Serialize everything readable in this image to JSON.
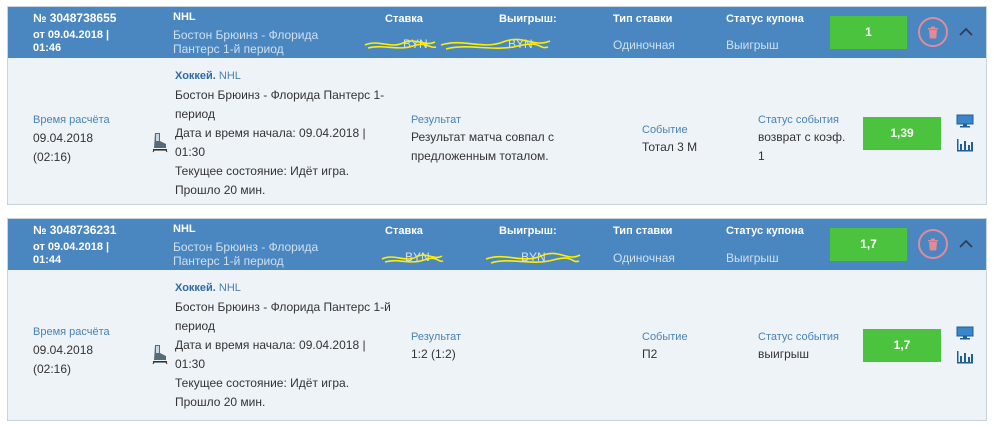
{
  "coupons": [
    {
      "number": "№ 3048738655",
      "date_line1": "от 09.04.2018 |",
      "date_line2": "01:46",
      "league": "NHL",
      "event_line1": "Бостон Брюинз - Флорида",
      "event_line2": "Пантерс 1-й период",
      "stake_label": "Ставка",
      "stake_value": "BYN",
      "win_label": "Выигрыш:",
      "win_value": "BYN",
      "bet_type_label": "Тип ставки",
      "bet_type_value": "Одиночная",
      "status_label": "Статус купона",
      "status_value": "Выигрыш",
      "coupon_odds": "1",
      "settle_label": "Время расчёта",
      "settle_line1": "09.04.2018",
      "settle_line2": "(02:16)",
      "sport": "Хоккей.",
      "sport_league": "NHL",
      "detail_event_line1": "Бостон Брюинз - Флорида Пантерс 1-",
      "detail_event_line2": "период",
      "start_line1": "Дата и время начала: 09.04.2018 |",
      "start_line2": "01:30",
      "state_line": "Текущее состояние: Идёт игра.",
      "elapsed_line": "Прошло 20 мин.",
      "result_label": "Результат",
      "result_line1": "Результат матча совпал с",
      "result_line2": "предложенным тоталом.",
      "event_label": "Событие",
      "event_value": "Тотал 3 М",
      "event_status_label": "Статус события",
      "event_status_line1": "возврат с коэф.",
      "event_status_line2": "1",
      "event_odds": "1,39"
    },
    {
      "number": "№ 3048736231",
      "date_line1": "от 09.04.2018 |",
      "date_line2": "01:44",
      "league": "NHL",
      "event_line1": "Бостон Брюинз - Флорида",
      "event_line2": "Пантерс 1-й период",
      "stake_label": "Ставка",
      "stake_value": "BYN",
      "win_label": "Выигрыш:",
      "win_value": "BYN",
      "bet_type_label": "Тип ставки",
      "bet_type_value": "Одиночная",
      "status_label": "Статус купона",
      "status_value": "Выигрыш",
      "coupon_odds": "1,7",
      "settle_label": "Время расчёта",
      "settle_line1": "09.04.2018",
      "settle_line2": "(02:16)",
      "sport": "Хоккей.",
      "sport_league": "NHL",
      "detail_event_line1": "Бостон Брюинз - Флорида Пантерс 1-й",
      "detail_event_line2": "период",
      "start_line1": "Дата и время начала: 09.04.2018 |",
      "start_line2": "01:30",
      "state_line": "Текущее состояние: Идёт игра.",
      "elapsed_line": "Прошло 20 мин.",
      "result_label": "Результат",
      "result_line1": "1:2 (1:2)",
      "result_line2": "",
      "event_label": "Событие",
      "event_value": "П2",
      "event_status_label": "Статус события",
      "event_status_line1": "выигрыш",
      "event_status_line2": "",
      "event_odds": "1,7"
    }
  ],
  "colors": {
    "header_bg": "#4a86c0",
    "body_bg": "#eef3f8",
    "accent_green": "#4cc33e",
    "scribble": "#ffee00",
    "trash_ring": "#e08a9a"
  },
  "icons": [
    "trash-icon",
    "chevron-up-icon",
    "hockey-skate-icon",
    "monitor-icon",
    "stats-chart-icon"
  ]
}
